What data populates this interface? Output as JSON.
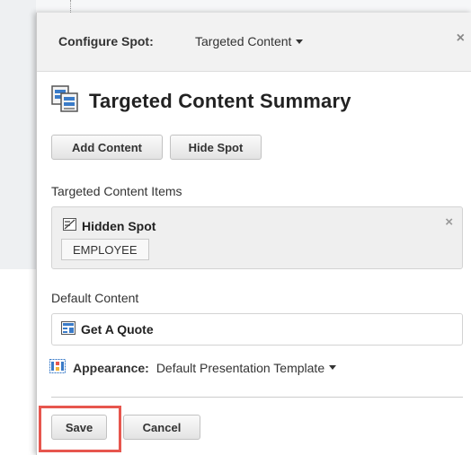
{
  "header": {
    "label": "Configure Spot:",
    "value": "Targeted Content",
    "close_glyph": "×"
  },
  "summary": {
    "title": "Targeted Content Summary",
    "icon": "targeted-content-icon"
  },
  "actions": {
    "add_content": "Add Content",
    "hide_spot": "Hide Spot"
  },
  "targeted_items": {
    "label": "Targeted Content Items",
    "items": [
      {
        "name": "Hidden Spot",
        "icon": "hidden-spot-icon",
        "tag": "EMPLOYEE",
        "close_glyph": "×"
      }
    ]
  },
  "default_content": {
    "label": "Default Content",
    "value": "Get A Quote",
    "icon": "content-icon"
  },
  "appearance": {
    "label": "Appearance:",
    "value": "Default Presentation Template",
    "icon": "appearance-icon"
  },
  "footer": {
    "save": "Save",
    "cancel": "Cancel"
  },
  "colors": {
    "highlight": "#e7564e",
    "icon_blue": "#3a7bc8"
  }
}
